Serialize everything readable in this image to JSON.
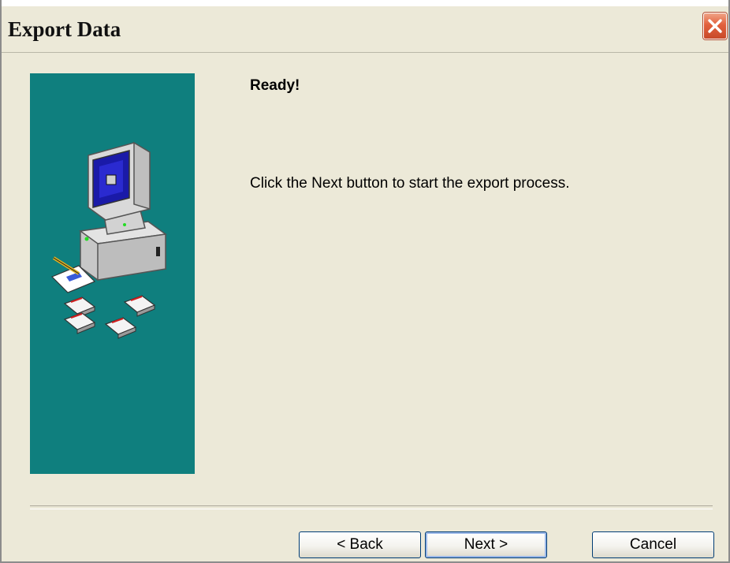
{
  "window": {
    "title": "Export Data"
  },
  "content": {
    "heading": "Ready!",
    "message": "Click the Next button to start the export process."
  },
  "buttons": {
    "back": "< Back",
    "next": "Next >",
    "cancel": "Cancel"
  },
  "icons": {
    "close": "close-icon",
    "illustration": "computer-export-illustration"
  },
  "colors": {
    "side_panel": "#0f7f7e",
    "close_button": "#e2603c",
    "dialog_background": "#ece9d8"
  }
}
